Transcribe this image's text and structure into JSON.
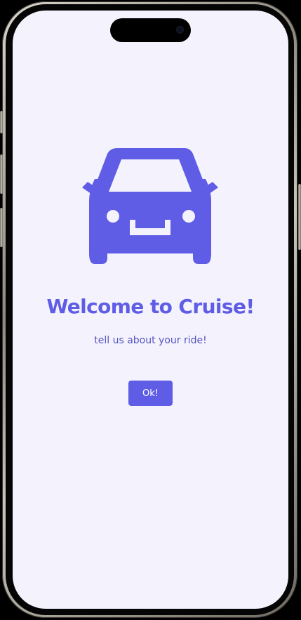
{
  "screen": {
    "background_color": "#f4f3fd",
    "accent_color": "#5f5ce6",
    "hero_icon": "car-front-icon",
    "title": "Welcome to Cruise!",
    "subtitle": "tell us about your ride!",
    "ok_button_label": "Ok!"
  }
}
